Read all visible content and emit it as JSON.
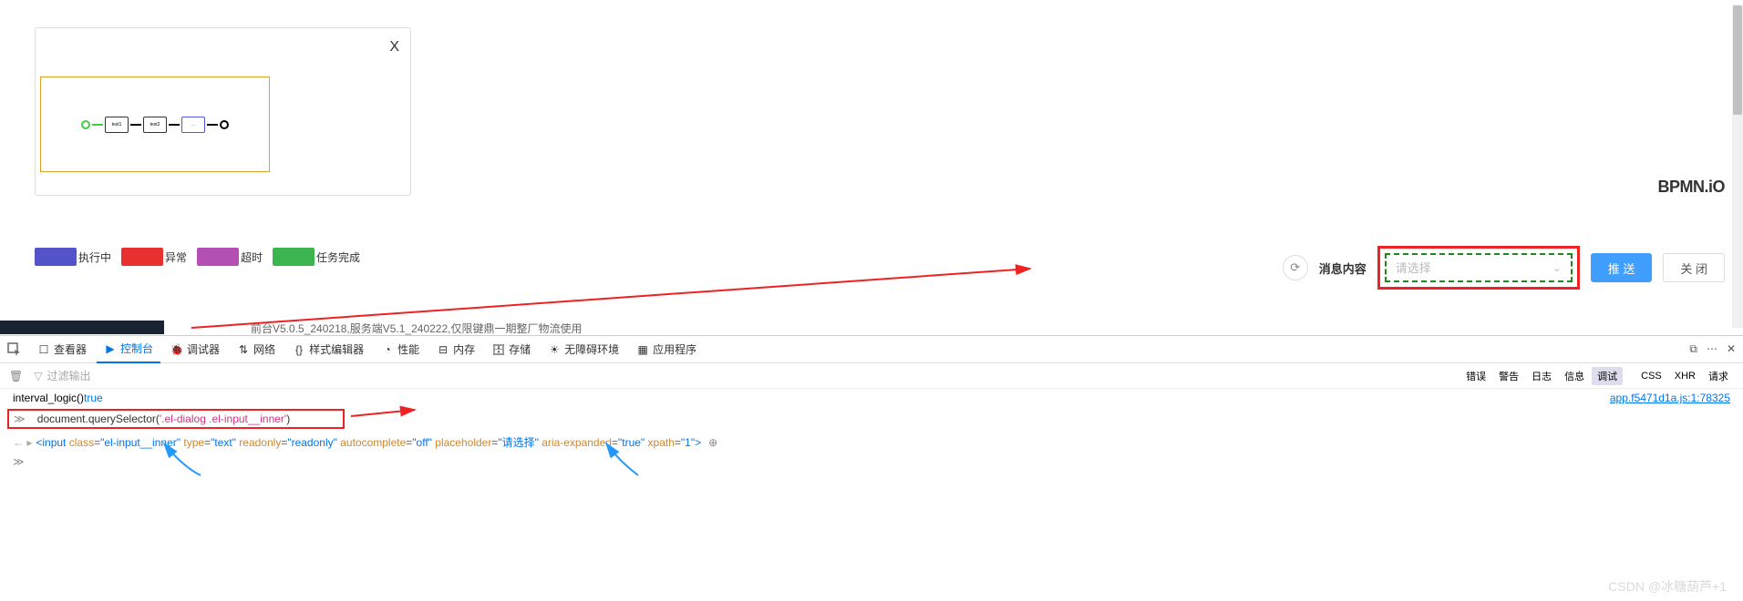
{
  "dialog": {
    "close": "X",
    "flow_nodes": [
      "test1",
      "test2",
      "..."
    ]
  },
  "bpmn_logo": "BPMN.iO",
  "legend": {
    "executing": "执行中",
    "abnormal": "异常",
    "timeout": "超时",
    "done": "任务完成"
  },
  "form": {
    "msg_label": "消息内容",
    "select_placeholder": "请选择",
    "push": "推 送",
    "close": "关 闭"
  },
  "version": "前台V5.0.5_240218,服务端V5.1_240222,仅限键鼎一期整厂物流使用",
  "devtools": {
    "tabs": {
      "inspector": "查看器",
      "console": "控制台",
      "debugger": "调试器",
      "network": "网络",
      "style": "样式编辑器",
      "performance": "性能",
      "memory": "内存",
      "storage": "存储",
      "a11y": "无障碍环境",
      "app": "应用程序"
    },
    "filter_placeholder": "过滤输出",
    "log_levels": {
      "error": "错误",
      "warn": "警告",
      "log": "日志",
      "info": "信息",
      "debug": "调试"
    },
    "extra_filters": {
      "css": "CSS",
      "xhr": "XHR",
      "req": "请求"
    },
    "console_log": {
      "text1": "interval_logic() ",
      "text2": "true",
      "src": "app.f5471d1a.js:1:78325"
    },
    "command": {
      "method": "document.querySelector",
      "arg": "'.el-dialog .el-input__inner'"
    },
    "result_html": "<input class=\"el-input__inner\" type=\"text\" readonly=\"readonly\" autocomplete=\"off\" placeholder=\"请选择\" aria-expanded=\"true\" xpath=\"1\">"
  },
  "watermark": "CSDN @冰糖葫芦+1"
}
